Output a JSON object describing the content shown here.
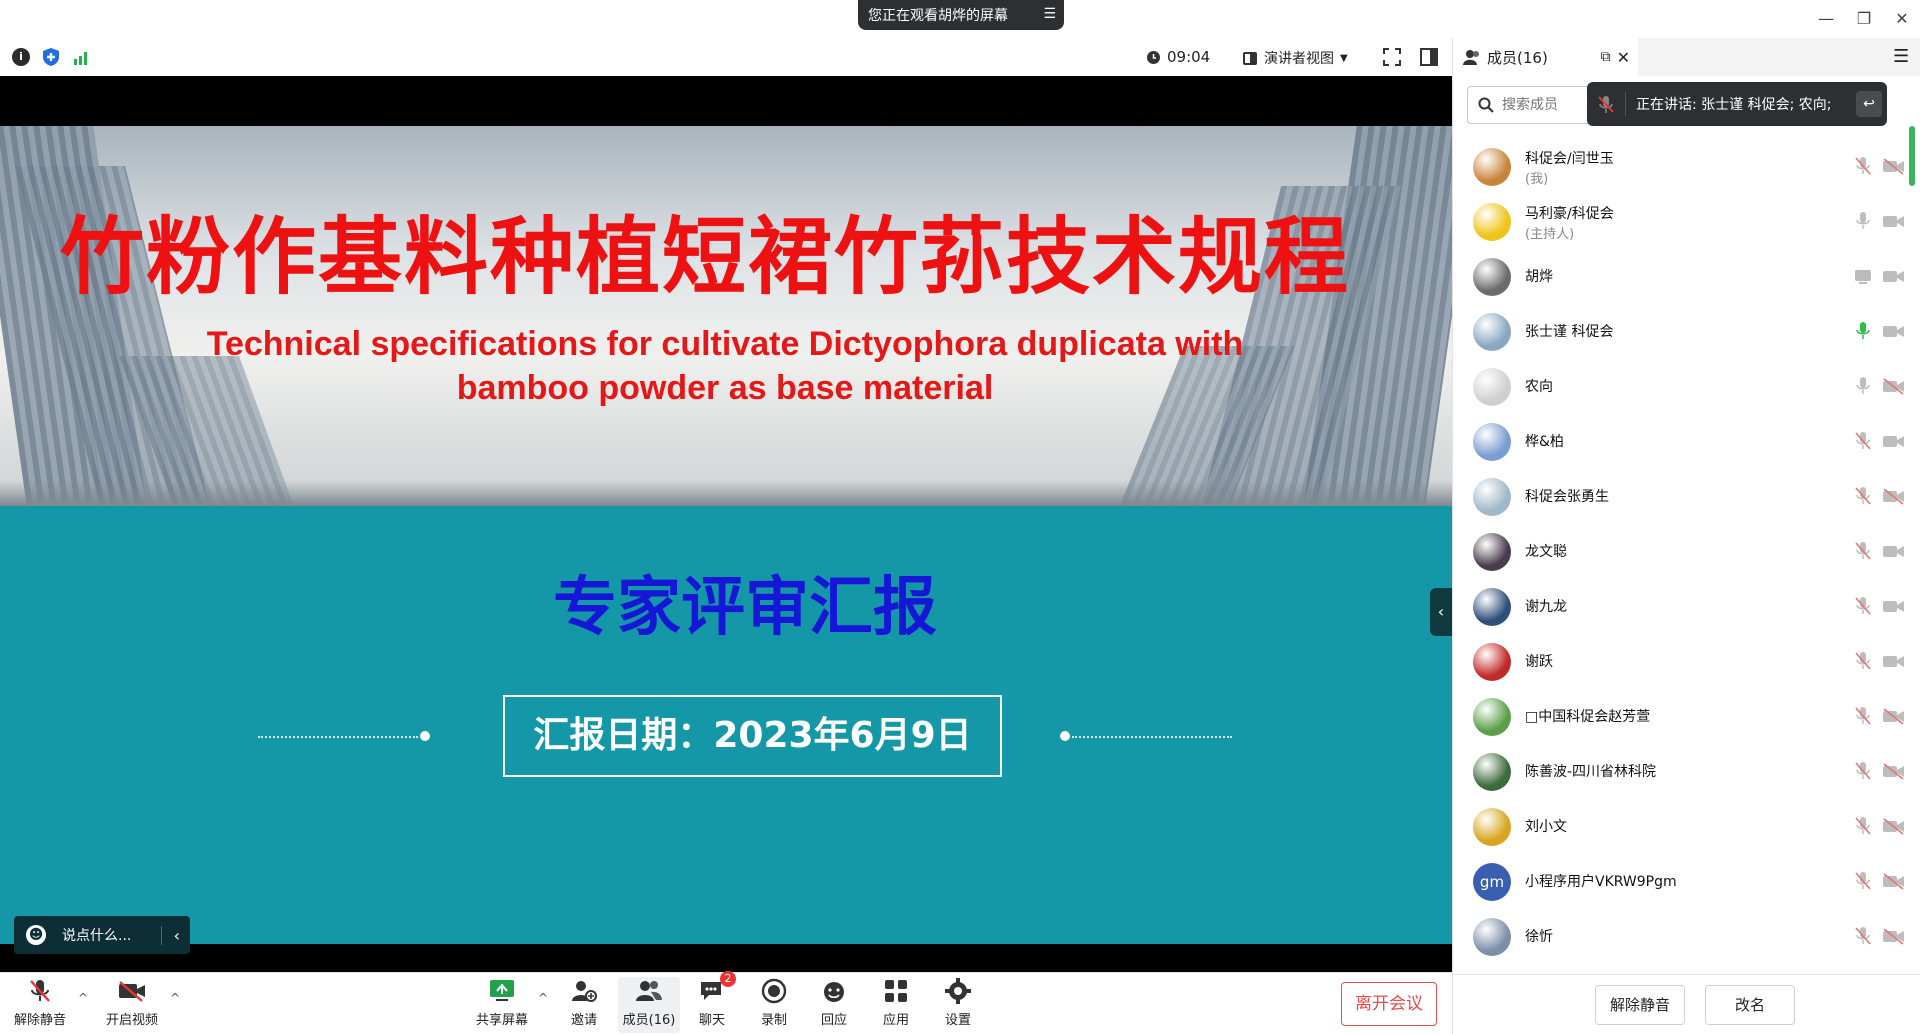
{
  "title_bar": {
    "share_banner": "您正在观看胡烨的屏幕"
  },
  "toolbar": {
    "timer": "09:04",
    "view_mode": "演讲者视图"
  },
  "slide": {
    "title_cn": "竹粉作基料种植短裙竹荪技术规程",
    "title_en_line1": "Technical specifications for cultivate Dictyophora duplicata with",
    "title_en_line2": "bamboo powder as base material",
    "report_title": "专家评审汇报",
    "date_label": "汇报日期：2023年6月9日"
  },
  "chat_input": {
    "placeholder": "说点什么..."
  },
  "bottom_bar": {
    "unmute": "解除静音",
    "start_video": "开启视频",
    "share_screen": "共享屏幕",
    "invite": "邀请",
    "members": "成员(16)",
    "chat": "聊天",
    "chat_badge": "2",
    "record": "录制",
    "reaction": "回应",
    "apps": "应用",
    "settings": "设置",
    "leave": "离开会议"
  },
  "panel": {
    "tab_label": "成员(16)",
    "search_placeholder": "搜索成员",
    "speaking_label": "正在讲话:  张士谨 科促会; 农向;",
    "footer_unmute": "解除静音",
    "footer_rename": "改名",
    "members": [
      {
        "name": "科促会/闫世玉",
        "role": "(我)",
        "mic": "muted",
        "cam": "off",
        "color": "#c9843c"
      },
      {
        "name": "马利豪/科促会",
        "role": "(主持人)",
        "mic": "on",
        "cam": "on",
        "color": "#f0c419"
      },
      {
        "name": "胡烨",
        "role": "",
        "mic": "share",
        "cam": "on",
        "color": "#6b6b6b"
      },
      {
        "name": "张士谨 科促会",
        "role": "",
        "mic": "speaking",
        "cam": "on",
        "color": "#8aa7c2"
      },
      {
        "name": "农向",
        "role": "",
        "mic": "on",
        "cam": "off",
        "color": "#cfcfcf"
      },
      {
        "name": "桦&柏",
        "role": "",
        "mic": "muted",
        "cam": "on",
        "color": "#7a9ed1"
      },
      {
        "name": "科促会张勇生",
        "role": "",
        "mic": "muted",
        "cam": "off",
        "color": "#9fb8c9"
      },
      {
        "name": "龙文聪",
        "role": "",
        "mic": "muted",
        "cam": "on",
        "color": "#4b3b4f"
      },
      {
        "name": "谢九龙",
        "role": "",
        "mic": "muted",
        "cam": "on",
        "color": "#2f4f7a"
      },
      {
        "name": "谢跃",
        "role": "",
        "mic": "muted",
        "cam": "on",
        "color": "#c22a2a"
      },
      {
        "name": "□中国科促会赵芳萱",
        "role": "",
        "mic": "muted",
        "cam": "off",
        "color": "#5aa04a"
      },
      {
        "name": "陈善波-四川省林科院",
        "role": "",
        "mic": "muted",
        "cam": "off",
        "color": "#3d6b3a"
      },
      {
        "name": "刘小文",
        "role": "",
        "mic": "muted",
        "cam": "off",
        "color": "#d9a520"
      },
      {
        "name": "小程序用户VKRW9Pgm",
        "role": "",
        "mic": "muted",
        "cam": "off",
        "color": "#3b5fb0",
        "initials": "gm"
      },
      {
        "name": "徐忻",
        "role": "",
        "mic": "muted",
        "cam": "off",
        "color": "#7d8fa8"
      }
    ]
  }
}
